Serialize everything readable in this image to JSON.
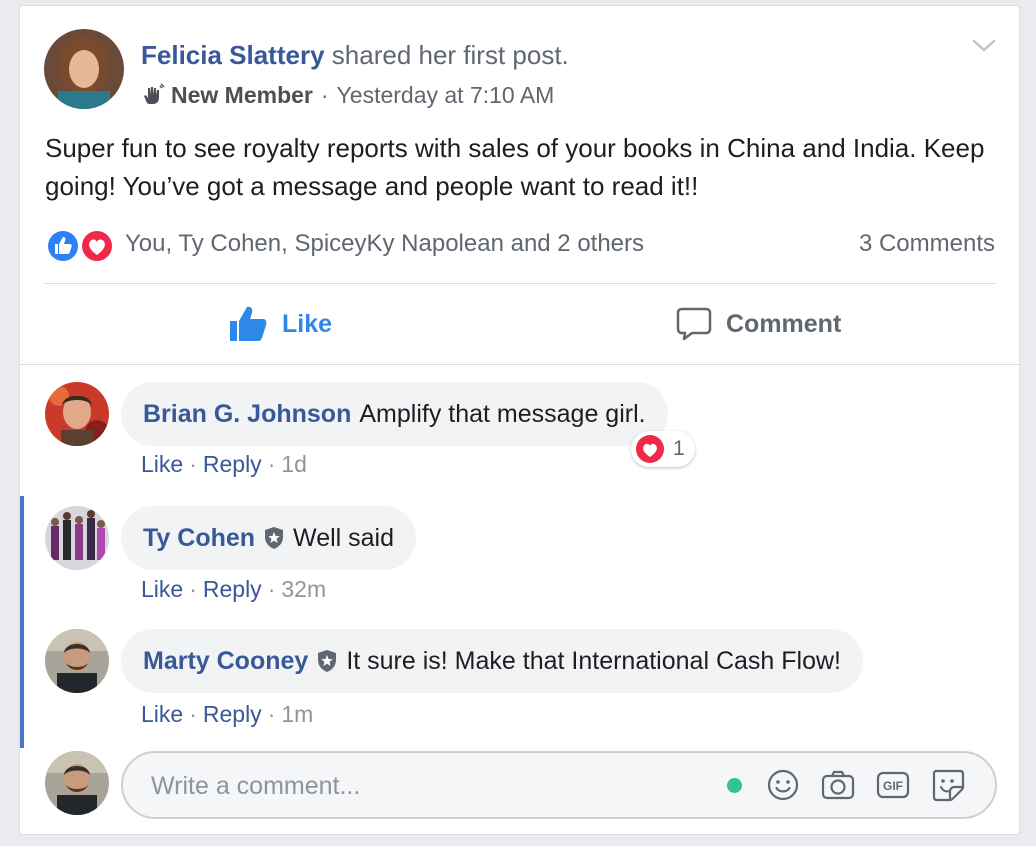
{
  "post": {
    "author": "Felicia Slattery",
    "action": "shared her first post.",
    "badge": "New Member",
    "time": "Yesterday at 7:10 AM",
    "text": "Super fun to see royalty reports with sales of your books in China and India. Keep going! You’ve got a message and people want to read it!!",
    "reactions_summary": "You, Ty Cohen, SpiceyKy Napolean and 2 others",
    "comments_count": "3 Comments"
  },
  "actions": {
    "like": "Like",
    "comment": "Comment"
  },
  "comments": [
    {
      "name": "Brian G. Johnson",
      "text": "Amplify that message girl.",
      "like": "Like",
      "reply": "Reply",
      "time": "1d",
      "reaction_count": "1"
    },
    {
      "name": "Ty Cohen",
      "text": "Well said",
      "like": "Like",
      "reply": "Reply",
      "time": "32m"
    },
    {
      "name": "Marty Cooney",
      "text": "It sure is! Make that International Cash Flow!",
      "like": "Like",
      "reply": "Reply",
      "time": "1m"
    }
  ],
  "composer": {
    "placeholder": "Write a comment..."
  },
  "colors": {
    "link_blue": "#385898",
    "like_blue": "#2d88e8",
    "thread_bar": "#4a76c7",
    "online_green": "#31c48d",
    "heart_red": "#f0284a"
  },
  "icons": [
    "chevron-down-icon",
    "wave-hand-icon",
    "like-reaction-icon",
    "love-reaction-icon",
    "thumbs-up-icon",
    "speech-bubble-icon",
    "shield-icon",
    "emoji-icon",
    "camera-icon",
    "gif-icon",
    "sticker-icon"
  ]
}
